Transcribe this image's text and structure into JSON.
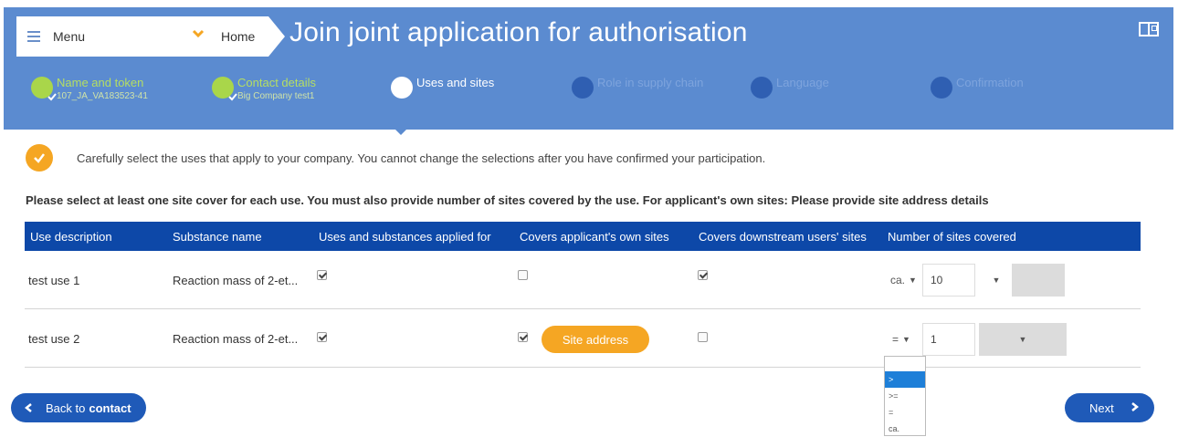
{
  "header": {
    "menu_label": "Menu",
    "home_label": "Home",
    "title": "Join joint application for authorisation"
  },
  "steps": [
    {
      "label": "Name and token",
      "sub": "107_JA_VA183523-41",
      "state": "done"
    },
    {
      "label": "Contact details",
      "sub": "Big Company test1",
      "state": "done"
    },
    {
      "label": "Uses and sites",
      "sub": "",
      "state": "current"
    },
    {
      "label": "Role in supply chain",
      "sub": "",
      "state": "todo"
    },
    {
      "label": "Language",
      "sub": "",
      "state": "todo"
    },
    {
      "label": "Confirmation",
      "sub": "",
      "state": "todo"
    }
  ],
  "notice": "Carefully select the uses that apply to your company. You cannot change the selections after you have confirmed your participation.",
  "instruction": "Please select at least one site cover for each use. You must also provide number of sites covered by the use. For applicant's own sites: Please provide site address details",
  "table": {
    "headers": [
      "Use description",
      "Substance name",
      "Uses and substances applied for",
      "Covers applicant's own sites",
      "Covers downstream users' sites",
      "Number of sites covered"
    ],
    "rows": [
      {
        "use": "test use 1",
        "substance": "Reaction mass of 2-et...",
        "applied": true,
        "own": true,
        "downstream": true,
        "qualifier": "ca.",
        "number": "10"
      },
      {
        "use": "test use 2",
        "substance": "Reaction mass of 2-et...",
        "applied": true,
        "own": true,
        "downstream": false,
        "qualifier": "=",
        "number": "1"
      }
    ],
    "site_address_label": "Site address"
  },
  "qualifier_options": [
    "",
    ">",
    ">=",
    "=",
    "ca."
  ],
  "buttons": {
    "back_prefix": "Back to",
    "back_target": "contact",
    "next": "Next"
  },
  "colors": {
    "header_blue": "#5b8bd0",
    "table_header": "#0d48a8",
    "accent_orange": "#f5a623",
    "step_done": "#a9d64a",
    "button_blue": "#1f5ab8"
  }
}
